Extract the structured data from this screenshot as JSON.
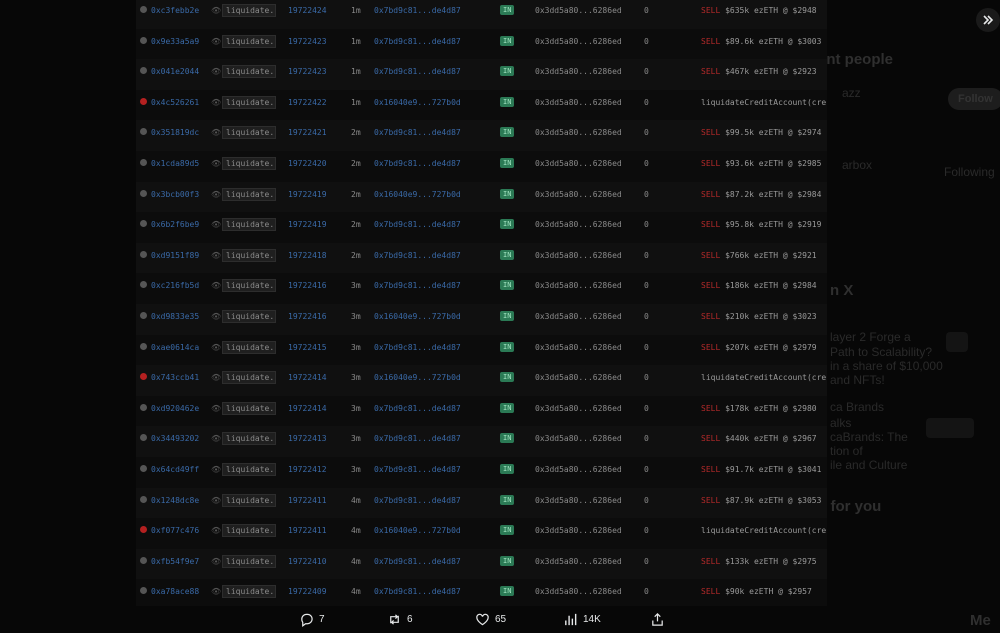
{
  "background": {
    "heading1": "ent people",
    "follow_label": "Follow",
    "following_label": "Following",
    "heading2": "n X",
    "heading3": "s for you",
    "snippets": [
      "azz",
      "arbox",
      "layer 2 Forge a",
      "Path to Scalability?",
      "in a share of $10,000",
      "and NFTs!",
      "ca Brands",
      "alks",
      "caBrands: The",
      "tion of",
      "ile and Culture",
      "Me"
    ]
  },
  "table": {
    "rows": [
      {
        "status": "ok",
        "tx": "0xc3febb2e",
        "method": "liquidate...",
        "block": "19722424",
        "age": "1m",
        "from": "0x7bd9c81...de4d87",
        "dir": "IN",
        "to": "0x3dd5a80...6286ed",
        "amount": "0",
        "action_prefix": "SELL",
        "action": "$635k ezETH @ $2948"
      },
      {
        "status": "ok",
        "tx": "0x9e33a5a9",
        "method": "liquidate...",
        "block": "19722423",
        "age": "1m",
        "from": "0x7bd9c81...de4d87",
        "dir": "IN",
        "to": "0x3dd5a80...6286ed",
        "amount": "0",
        "action_prefix": "SELL",
        "action": "$89.6k ezETH @ $3003"
      },
      {
        "status": "ok",
        "tx": "0x041e2044",
        "method": "liquidate...",
        "block": "19722423",
        "age": "1m",
        "from": "0x7bd9c81...de4d87",
        "dir": "IN",
        "to": "0x3dd5a80...6286ed",
        "amount": "0",
        "action_prefix": "SELL",
        "action": "$467k ezETH @ $2923"
      },
      {
        "status": "err",
        "tx": "0x4c526261",
        "method": "liquidate...",
        "block": "19722422",
        "age": "1m",
        "from": "0x16040e9...727b0d",
        "dir": "IN",
        "to": "0x3dd5a80...6286ed",
        "amount": "0",
        "action_prefix": "",
        "action": "liquidateCreditAccount(cre"
      },
      {
        "status": "ok",
        "tx": "0x351819dc",
        "method": "liquidate...",
        "block": "19722421",
        "age": "2m",
        "from": "0x7bd9c81...de4d87",
        "dir": "IN",
        "to": "0x3dd5a80...6286ed",
        "amount": "0",
        "action_prefix": "SELL",
        "action": "$99.5k ezETH @ $2974"
      },
      {
        "status": "ok",
        "tx": "0x1cda89d5",
        "method": "liquidate...",
        "block": "19722420",
        "age": "2m",
        "from": "0x7bd9c81...de4d87",
        "dir": "IN",
        "to": "0x3dd5a80...6286ed",
        "amount": "0",
        "action_prefix": "SELL",
        "action": "$93.6k ezETH @ $2985"
      },
      {
        "status": "ok",
        "tx": "0x3bcb00f3",
        "method": "liquidate...",
        "block": "19722419",
        "age": "2m",
        "from": "0x16040e9...727b0d",
        "dir": "IN",
        "to": "0x3dd5a80...6286ed",
        "amount": "0",
        "action_prefix": "SELL",
        "action": "$87.2k ezETH @ $2984"
      },
      {
        "status": "ok",
        "tx": "0x6b2f6be9",
        "method": "liquidate...",
        "block": "19722419",
        "age": "2m",
        "from": "0x7bd9c81...de4d87",
        "dir": "IN",
        "to": "0x3dd5a80...6286ed",
        "amount": "0",
        "action_prefix": "SELL",
        "action": "$95.8k ezETH @ $2919"
      },
      {
        "status": "ok",
        "tx": "0xd9151f89",
        "method": "liquidate...",
        "block": "19722418",
        "age": "2m",
        "from": "0x7bd9c81...de4d87",
        "dir": "IN",
        "to": "0x3dd5a80...6286ed",
        "amount": "0",
        "action_prefix": "SELL",
        "action": "$766k ezETH @ $2921"
      },
      {
        "status": "ok",
        "tx": "0xc216fb5d",
        "method": "liquidate...",
        "block": "19722416",
        "age": "3m",
        "from": "0x7bd9c81...de4d87",
        "dir": "IN",
        "to": "0x3dd5a80...6286ed",
        "amount": "0",
        "action_prefix": "SELL",
        "action": "$186k ezETH @ $2984"
      },
      {
        "status": "ok",
        "tx": "0xd9833e35",
        "method": "liquidate...",
        "block": "19722416",
        "age": "3m",
        "from": "0x16040e9...727b0d",
        "dir": "IN",
        "to": "0x3dd5a80...6286ed",
        "amount": "0",
        "action_prefix": "SELL",
        "action": "$210k ezETH @ $3023"
      },
      {
        "status": "ok",
        "tx": "0xae0614ca",
        "method": "liquidate...",
        "block": "19722415",
        "age": "3m",
        "from": "0x7bd9c81...de4d87",
        "dir": "IN",
        "to": "0x3dd5a80...6286ed",
        "amount": "0",
        "action_prefix": "SELL",
        "action": "$207k ezETH @ $2979"
      },
      {
        "status": "err",
        "tx": "0x743ccb41",
        "method": "liquidate...",
        "block": "19722414",
        "age": "3m",
        "from": "0x16040e9...727b0d",
        "dir": "IN",
        "to": "0x3dd5a80...6286ed",
        "amount": "0",
        "action_prefix": "",
        "action": "liquidateCreditAccount(cre"
      },
      {
        "status": "ok",
        "tx": "0xd920462e",
        "method": "liquidate...",
        "block": "19722414",
        "age": "3m",
        "from": "0x7bd9c81...de4d87",
        "dir": "IN",
        "to": "0x3dd5a80...6286ed",
        "amount": "0",
        "action_prefix": "SELL",
        "action": "$178k ezETH @ $2980"
      },
      {
        "status": "ok",
        "tx": "0x34493202",
        "method": "liquidate...",
        "block": "19722413",
        "age": "3m",
        "from": "0x7bd9c81...de4d87",
        "dir": "IN",
        "to": "0x3dd5a80...6286ed",
        "amount": "0",
        "action_prefix": "SELL",
        "action": "$440k ezETH @ $2967"
      },
      {
        "status": "ok",
        "tx": "0x64cd49ff",
        "method": "liquidate...",
        "block": "19722412",
        "age": "3m",
        "from": "0x7bd9c81...de4d87",
        "dir": "IN",
        "to": "0x3dd5a80...6286ed",
        "amount": "0",
        "action_prefix": "SELL",
        "action": "$91.7k ezETH @ $3041"
      },
      {
        "status": "ok",
        "tx": "0x1248dc8e",
        "method": "liquidate...",
        "block": "19722411",
        "age": "4m",
        "from": "0x7bd9c81...de4d87",
        "dir": "IN",
        "to": "0x3dd5a80...6286ed",
        "amount": "0",
        "action_prefix": "SELL",
        "action": "$87.9k ezETH @ $3053"
      },
      {
        "status": "err",
        "tx": "0xf077c476",
        "method": "liquidate...",
        "block": "19722411",
        "age": "4m",
        "from": "0x16040e9...727b0d",
        "dir": "IN",
        "to": "0x3dd5a80...6286ed",
        "amount": "0",
        "action_prefix": "",
        "action": "liquidateCreditAccount(cre"
      },
      {
        "status": "ok",
        "tx": "0xfb54f9e7",
        "method": "liquidate...",
        "block": "19722410",
        "age": "4m",
        "from": "0x7bd9c81...de4d87",
        "dir": "IN",
        "to": "0x3dd5a80...6286ed",
        "amount": "0",
        "action_prefix": "SELL",
        "action": "$133k ezETH @ $2975"
      },
      {
        "status": "ok",
        "tx": "0xa78ace88",
        "method": "liquidate...",
        "block": "19722409",
        "age": "4m",
        "from": "0x7bd9c81...de4d87",
        "dir": "IN",
        "to": "0x3dd5a80...6286ed",
        "amount": "0",
        "action_prefix": "SELL",
        "action": "$90k ezETH @ $2957"
      }
    ]
  },
  "actions": {
    "replies": "7",
    "reposts": "6",
    "likes": "65",
    "views": "14K"
  },
  "colors": {
    "sell": "#b52a2a",
    "link": "#3a6aa8",
    "in_badge": "#2b7a55",
    "error_dot": "#b42020"
  }
}
